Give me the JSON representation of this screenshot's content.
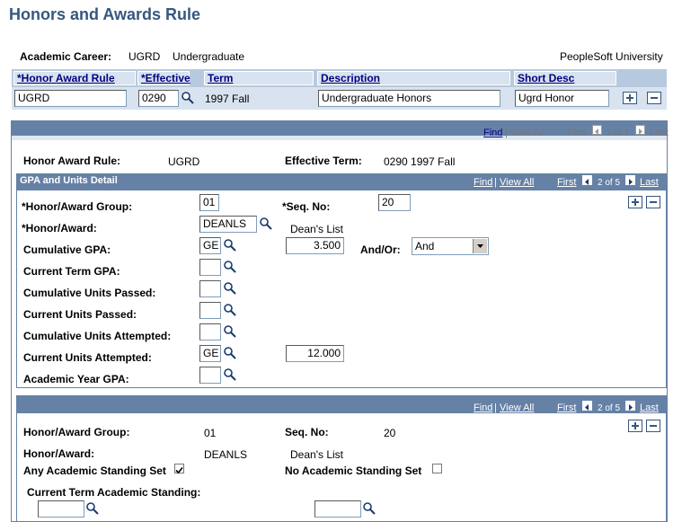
{
  "page": {
    "title": "Honors and Awards Rule"
  },
  "career": {
    "label": "Academic Career:",
    "code": "UGRD",
    "name": "Undergraduate",
    "institution": "PeopleSoft University"
  },
  "grid": {
    "headers": [
      "*Honor Award Rule",
      "*Effective",
      "Term",
      "Description",
      "Short Desc"
    ],
    "row": {
      "rule": "UGRD",
      "effective": "0290",
      "term": "1997 Fall",
      "description": "Undergraduate Honors",
      "short_desc": "Ugrd Honor"
    }
  },
  "outer_nav": {
    "find": "Find",
    "sep": "|",
    "view_all": "View All",
    "first": "First",
    "count": "1 of 1",
    "last": "Last"
  },
  "outer": {
    "rule_label": "Honor Award Rule:",
    "rule_value": "UGRD",
    "term_label": "Effective Term:",
    "term_value": "0290  1997 Fall"
  },
  "gpa_section": {
    "title": "GPA and Units Detail",
    "find": "Find",
    "sep": "|",
    "view_all": "View All",
    "first": "First",
    "count": "2 of 5",
    "last": "Last",
    "group_label": "*Honor/Award Group:",
    "group_value": "01",
    "seq_label": "*Seq. No:",
    "seq_value": "20",
    "award_label": "*Honor/Award:",
    "award_value": "DEANLS",
    "award_desc": "Dean's List",
    "cum_gpa_label": "Cumulative GPA:",
    "cum_gpa_op": "GE",
    "cum_gpa_value": "3.500",
    "andor_label": "And/Or:",
    "andor_value": "And",
    "cur_term_gpa_label": "Current Term GPA:",
    "cum_units_passed_label": "Cumulative Units Passed:",
    "cur_units_passed_label": "Current Units Passed:",
    "cum_units_attempted_label": "Cumulative Units Attempted:",
    "cur_units_attempted_label": "Current Units Attempted:",
    "cur_units_attempted_op": "GE",
    "cur_units_attempted_value": "12.000",
    "acad_year_gpa_label": "Academic Year GPA:"
  },
  "standing_section": {
    "find": "Find",
    "sep": "|",
    "view_all": "View All",
    "first": "First",
    "count": "2 of 5",
    "last": "Last",
    "group_label": "Honor/Award Group:",
    "group_value": "01",
    "seq_label": "Seq. No:",
    "seq_value": "20",
    "award_label": "Honor/Award:",
    "award_value": "DEANLS",
    "award_desc": "Dean's List",
    "any_label": "Any Academic Standing Set",
    "any_checked": true,
    "none_label": "No Academic Standing Set",
    "none_checked": false,
    "cur_term_label": "Current Term Academic Standing:"
  },
  "colors": {
    "title": "#36577e",
    "header_band": "#6681a6",
    "grid_header": "#b7c9de",
    "grid_row": "#d8e3ef",
    "link": "#000080"
  }
}
